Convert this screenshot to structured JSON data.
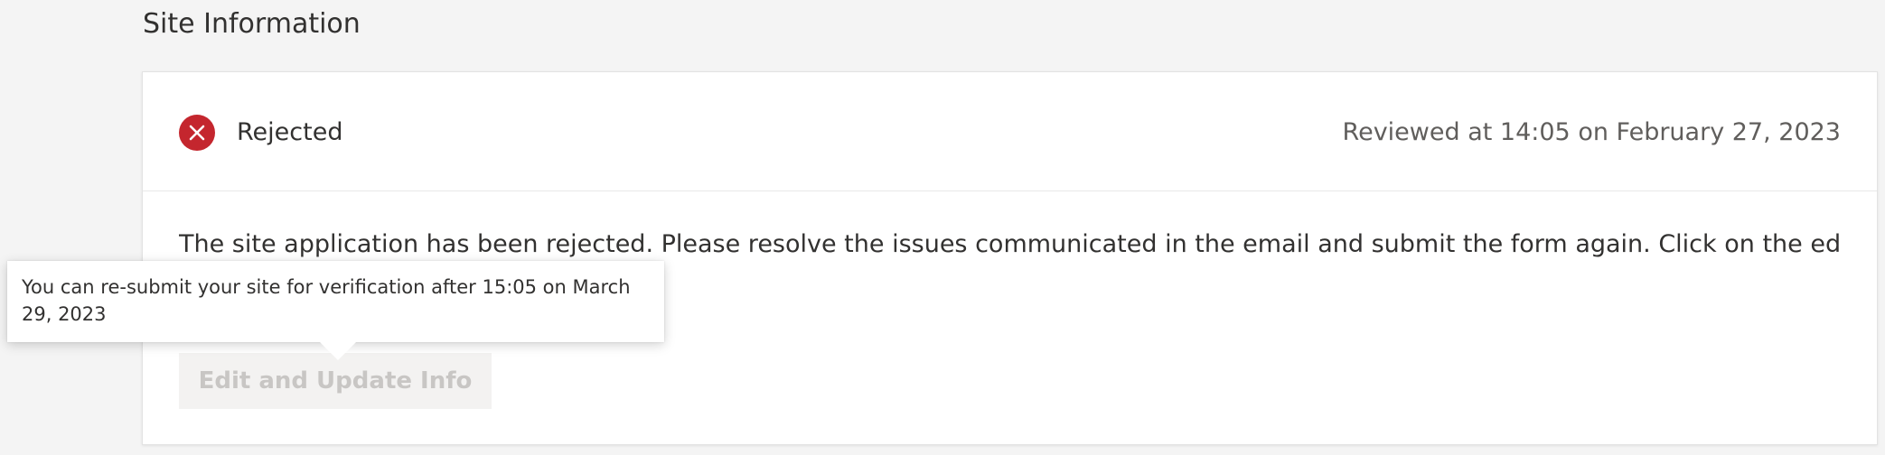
{
  "section": {
    "title": "Site Information"
  },
  "status": {
    "label": "Rejected",
    "icon": "error-circle-icon",
    "color": "#c4262e",
    "reviewed_text": "Reviewed at 14:05 on February 27, 2023"
  },
  "message": "The site application has been rejected. Please resolve the issues communicated in the email and submit the form again. Click on the edit form below",
  "edit_button": {
    "label": "Edit and Update Info",
    "disabled": true
  },
  "tooltip": {
    "text": "You can re-submit your site for verification after 15:05 on March 29, 2023"
  }
}
